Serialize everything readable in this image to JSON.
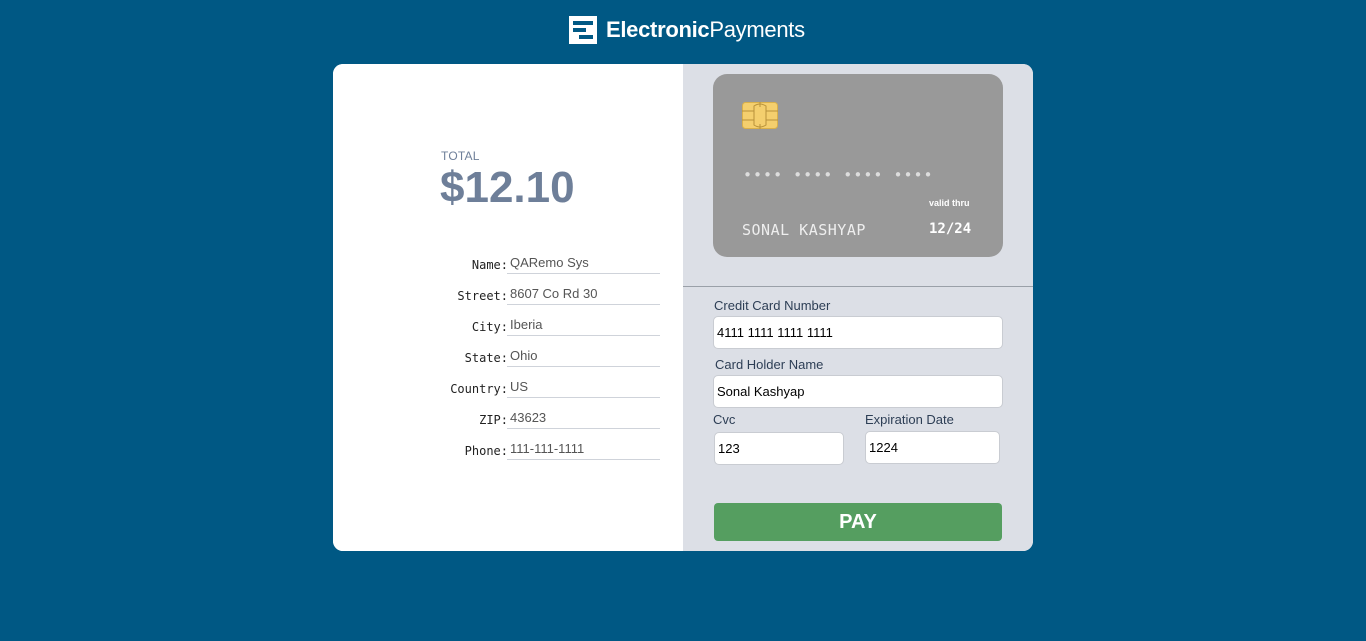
{
  "brand": {
    "logo_icon": "electronic-payments-logo-icon",
    "name_bold": "Electronic",
    "name_light": "Payments"
  },
  "summary": {
    "total_label": "TOTAL",
    "total_amount": "$12.10"
  },
  "billing": [
    {
      "label": "Name:",
      "value": "QARemo Sys"
    },
    {
      "label": "Street:",
      "value": "8607 Co Rd 30"
    },
    {
      "label": "City:",
      "value": "Iberia"
    },
    {
      "label": "State:",
      "value": "Ohio"
    },
    {
      "label": "Country:",
      "value": "US"
    },
    {
      "label": "ZIP:",
      "value": "43623"
    },
    {
      "label": "Phone:",
      "value": "111-111-1111"
    }
  ],
  "card_preview": {
    "chip_icon": "card-chip-icon",
    "number_mask": "•••• •••• •••• ••••",
    "holder": "SONAL KASHYAP",
    "valid_label": "valid thru",
    "expiry": "12/24"
  },
  "form": {
    "card_number": {
      "label": "Credit Card Number",
      "value": "4111 1111 1111 1111"
    },
    "holder_name": {
      "label": "Card Holder Name",
      "value": "Sonal Kashyap"
    },
    "cvc": {
      "label": "Cvc",
      "value": "123"
    },
    "expiration": {
      "label": "Expiration Date",
      "value": "1224"
    },
    "pay_label": "PAY"
  },
  "colors": {
    "background": "#005884",
    "total": "#6e7f99",
    "right_panel": "#dcdfe6",
    "card": "#999999",
    "chip": "#f4cf6e",
    "pay_button": "#559e60"
  }
}
